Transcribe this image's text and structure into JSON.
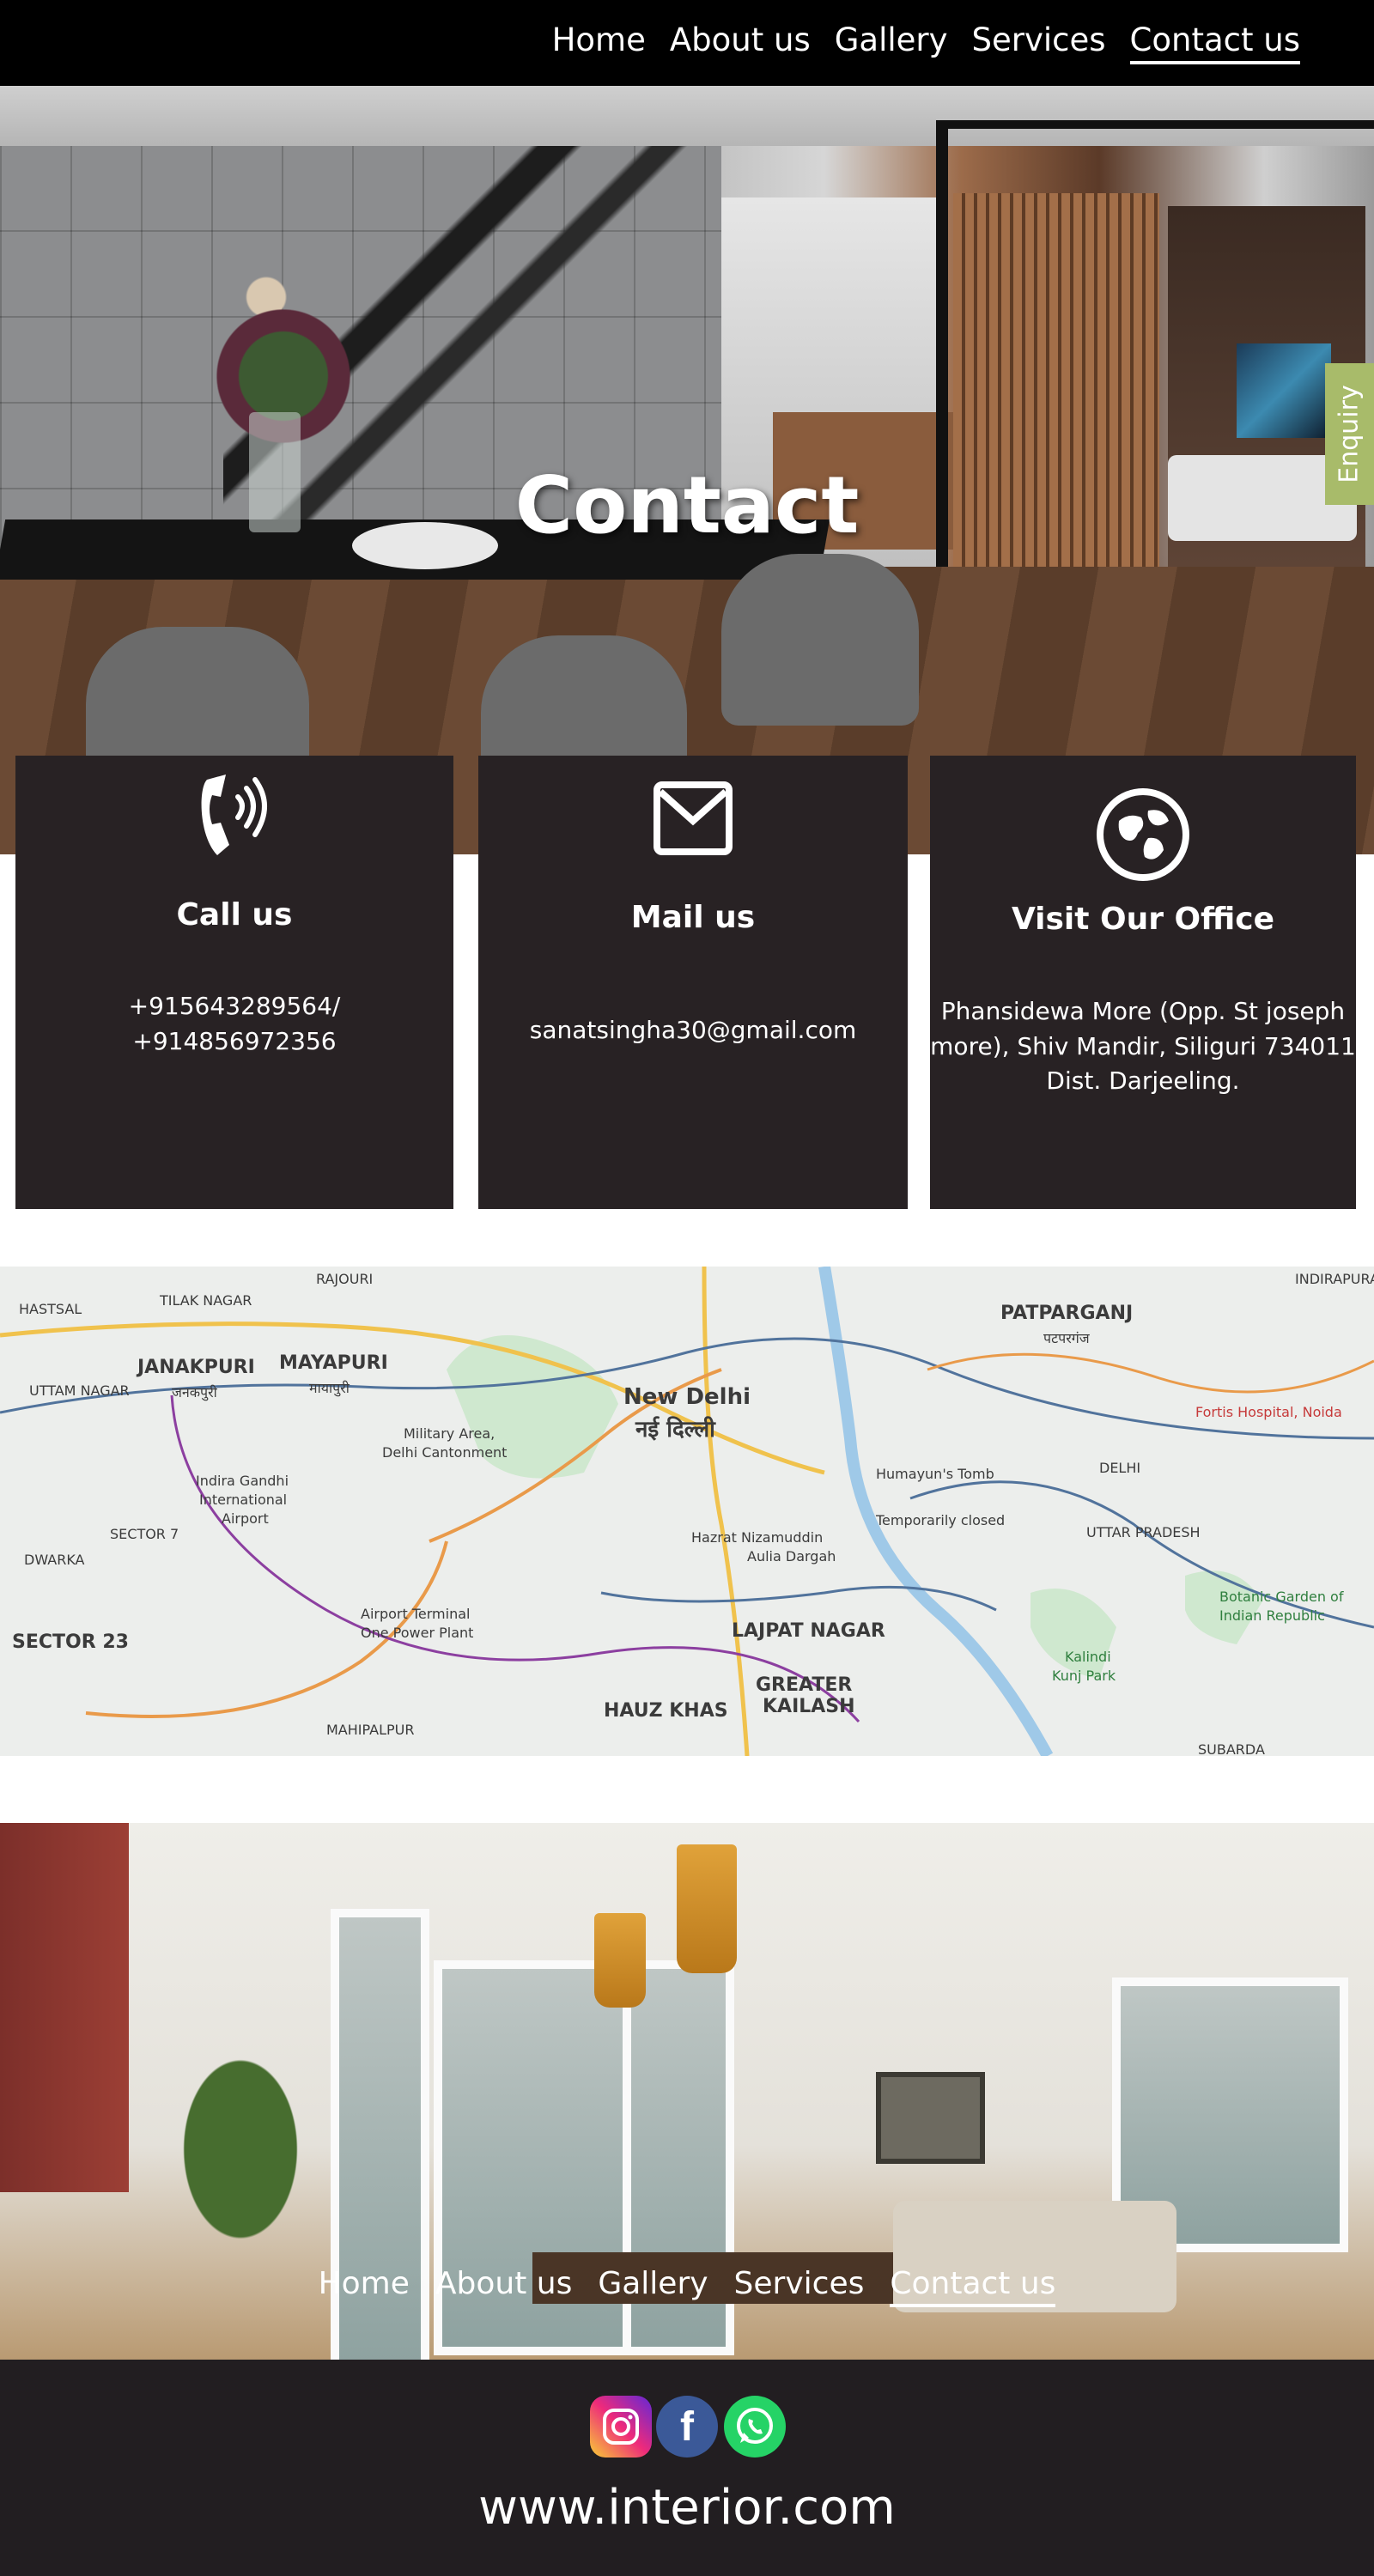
{
  "nav": {
    "items": [
      {
        "label": "Home",
        "active": false
      },
      {
        "label": "About us",
        "active": false
      },
      {
        "label": "Gallery",
        "active": false
      },
      {
        "label": "Services",
        "active": false
      },
      {
        "label": "Contact us",
        "active": true
      }
    ]
  },
  "hero": {
    "title": "Contact",
    "enquiry_label": "Enquiry"
  },
  "cards": {
    "call": {
      "icon": "phone-icon",
      "title": "Call us",
      "line1": "+915643289564/",
      "line2": "+914856972356"
    },
    "mail": {
      "icon": "mail-icon",
      "title": "Mail us",
      "line1": "sanatsingha30@gmail.com"
    },
    "visit": {
      "icon": "globe-icon",
      "title": "Visit Our Office",
      "line1": "Phansidewa More (Opp. St joseph",
      "line2": "more), Shiv Mandir, Siliguri 734011",
      "line3": "Dist. Darjeeling."
    }
  },
  "map": {
    "labels": {
      "new_delhi": "New Delhi",
      "new_delhi_hi": "नई दिल्ली",
      "janakpuri": "JANAKPURI",
      "janakpuri_hi": "जनकपुरी",
      "mayapuri": "MAYAPURI",
      "mayapuri_hi": "मायापुरी",
      "patparganj": "PATPARGANJ",
      "patparganj_hi": "पटपरगंज",
      "military_area": "Military Area,",
      "delhi_cantonment": "Delhi Cantonment",
      "igi_airport_1": "Indira Gandhi",
      "igi_airport_2": "International",
      "igi_airport_3": "Airport",
      "humayuns_tomb": "Humayun's Tomb",
      "temporarily_closed": "Temporarily closed",
      "hazrat_1": "Hazrat Nizamuddin",
      "hazrat_2": "Aulia Dargah",
      "lajpat_nagar": "LAJPAT NAGAR",
      "greater_kailash_1": "GREATER",
      "greater_kailash_2": "KAILASH",
      "hauz_khas": "HAUZ KHAS",
      "sector_23": "SECTOR 23",
      "airport_terminal_1": "Airport Terminal",
      "airport_terminal_2": "One Power Plant",
      "fortis": "Fortis Hospital, Noida",
      "botanic_1": "Botanic Garden of",
      "botanic_2": "Indian Republic",
      "kalindi_1": "Kalindi",
      "kalindi_2": "Kunj Park",
      "uttar_pradesh": "UTTAR PRADESH",
      "delhi": "DELHI",
      "uttam_nagar": "UTTAM NAGAR",
      "tilak_nagar": "TILAK NAGAR",
      "hastsal": "HASTSAL",
      "dwarka": "DWARKA",
      "sector7": "SECTOR 7",
      "mahipalpur": "MAHIPALPUR",
      "rajouri": "RAJOURI",
      "indirapuram": "INDIRAPURAM",
      "subarea": "SUBARDA"
    }
  },
  "footer": {
    "social": [
      {
        "name": "instagram-icon"
      },
      {
        "name": "facebook-icon",
        "glyph": "f"
      },
      {
        "name": "whatsapp-icon"
      }
    ],
    "url": "www.interior.com"
  },
  "colors": {
    "nav_bg": "#000000",
    "card_bg": "#282224",
    "enquiry_bg": "#a8bb6a",
    "footer_bg": "#221e21"
  }
}
